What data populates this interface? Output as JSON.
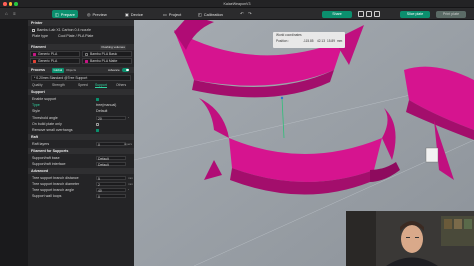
{
  "window": {
    "title": "KalaeWeaponV3",
    "traffic_colors": [
      "#ff5f57",
      "#febc2e",
      "#28c840"
    ]
  },
  "toolbar": {
    "tabs": [
      {
        "label": "Prepare",
        "icon": "prepare-icon",
        "glyph": "◫",
        "active": true
      },
      {
        "label": "Preview",
        "icon": "preview-icon",
        "glyph": "◎",
        "active": false
      },
      {
        "label": "Device",
        "icon": "device-icon",
        "glyph": "▣",
        "active": false
      },
      {
        "label": "Project",
        "icon": "project-icon",
        "glyph": "▭",
        "active": false
      },
      {
        "label": "Calibration",
        "icon": "calibration-icon",
        "glyph": "◰",
        "active": false
      }
    ],
    "share_label": "Share",
    "slice_label": "Slice plate",
    "print_label": "Print plate",
    "accent": "#0b8f6e"
  },
  "printer": {
    "header": "Printer",
    "model": "Bambu Lab X1 Carbon 0.4 nozzle",
    "plate_type_label": "Plate type",
    "plate_type_value": "Cool Plate / PLA Plate"
  },
  "filament": {
    "header": "Filament",
    "flushing_label": "Flushing volumes",
    "items": [
      {
        "num": "1",
        "name": "Generic PLA",
        "color": "#c71585"
      },
      {
        "num": "2",
        "name": "Bambu PLA Basic",
        "color": "#1a1a1a"
      },
      {
        "num": "3",
        "name": "Generic PLA",
        "color": "#e34234"
      },
      {
        "num": "4",
        "name": "Bambu PLA Matte",
        "color": "#c71585"
      }
    ]
  },
  "process": {
    "header": "Process",
    "global_label": "Global",
    "objects_label": "Objects",
    "advance_label": "Advance",
    "preset": "* 0.20mm Standard @Tree Support",
    "tabs": [
      {
        "label": "Quality",
        "active": false
      },
      {
        "label": "Strength",
        "active": false
      },
      {
        "label": "Speed",
        "active": false
      },
      {
        "label": "Support",
        "active": true
      },
      {
        "label": "Others",
        "active": false
      }
    ]
  },
  "support": {
    "header": "Support",
    "enable_label": "Enable support",
    "type_label": "Type",
    "type_value": "tree(manual)",
    "style_label": "Style",
    "style_value": "Default",
    "threshold_label": "Threshold angle",
    "threshold_value": "20",
    "threshold_unit": "°",
    "on_build_plate_label": "On build plate only",
    "remove_small_label": "Remove small overhangs"
  },
  "raft": {
    "header": "Raft",
    "layers_label": "Raft layers",
    "layers_value": "0",
    "layers_unit": "layers"
  },
  "filament_supports": {
    "header": "Filament for Supports",
    "base_label": "Support/raft base",
    "base_value": "Default",
    "interface_label": "Support/raft interface",
    "interface_value": "Default"
  },
  "advanced": {
    "header": "Advanced",
    "rows": [
      {
        "label": "Tree support branch distance",
        "value": "5",
        "unit": "mm"
      },
      {
        "label": "Tree support branch diameter",
        "value": "2",
        "unit": "mm"
      },
      {
        "label": "Tree support branch angle",
        "value": "40",
        "unit": "°"
      },
      {
        "label": "Support wall loops",
        "value": "0",
        "unit": ""
      }
    ]
  },
  "overlay": {
    "world_label": "World coordinates",
    "position_label": "Position :",
    "x": "-115.85",
    "y": "42.13",
    "z": "15.89",
    "unit": "mm"
  },
  "colors": {
    "model_magenta": "#d6148f",
    "viewport_bg": "#9aa0a6"
  }
}
